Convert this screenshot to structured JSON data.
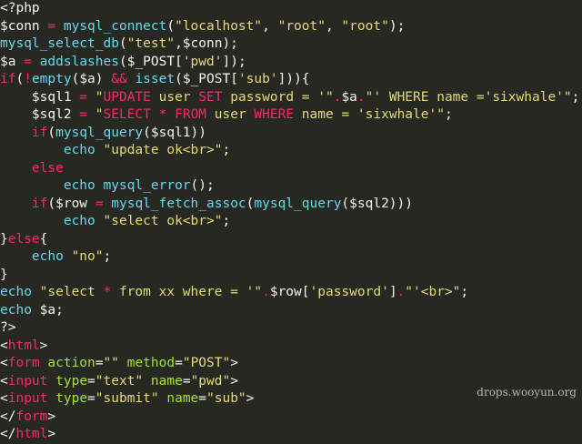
{
  "colors": {
    "background": "#272822",
    "default": "#f8f8f2",
    "function": "#66d9ef",
    "keyword": "#f92672",
    "string": "#e6db74",
    "attribute": "#a6e22e"
  },
  "watermark": "drops.wooyun.org",
  "lines": [
    [
      {
        "t": "<?php",
        "c": "default"
      }
    ],
    [
      {
        "t": "$conn",
        "c": "var"
      },
      {
        "t": " = ",
        "c": "op"
      },
      {
        "t": "mysql_connect",
        "c": "func"
      },
      {
        "t": "(",
        "c": "default"
      },
      {
        "t": "\"localhost\"",
        "c": "str"
      },
      {
        "t": ", ",
        "c": "default"
      },
      {
        "t": "\"root\"",
        "c": "str"
      },
      {
        "t": ", ",
        "c": "default"
      },
      {
        "t": "\"root\"",
        "c": "str"
      },
      {
        "t": ");",
        "c": "default"
      }
    ],
    [
      {
        "t": "mysql_select_db",
        "c": "func"
      },
      {
        "t": "(",
        "c": "default"
      },
      {
        "t": "\"test\"",
        "c": "str"
      },
      {
        "t": ",$conn);",
        "c": "default"
      }
    ],
    [
      {
        "t": "$a",
        "c": "var"
      },
      {
        "t": " = ",
        "c": "op"
      },
      {
        "t": "addslashes",
        "c": "func"
      },
      {
        "t": "($_POST[",
        "c": "default"
      },
      {
        "t": "'pwd'",
        "c": "str"
      },
      {
        "t": "]);",
        "c": "default"
      }
    ],
    [
      {
        "t": "if",
        "c": "kw"
      },
      {
        "t": "(",
        "c": "default"
      },
      {
        "t": "!",
        "c": "op"
      },
      {
        "t": "empty",
        "c": "func"
      },
      {
        "t": "($a) ",
        "c": "default"
      },
      {
        "t": "&&",
        "c": "op"
      },
      {
        "t": " ",
        "c": "default"
      },
      {
        "t": "isset",
        "c": "func"
      },
      {
        "t": "($_POST[",
        "c": "default"
      },
      {
        "t": "'sub'",
        "c": "str"
      },
      {
        "t": "])){",
        "c": "default"
      }
    ],
    [
      {
        "t": "    $sql1",
        "c": "var"
      },
      {
        "t": " = ",
        "c": "op"
      },
      {
        "t": "\"",
        "c": "str"
      },
      {
        "t": "UPDATE",
        "c": "kw"
      },
      {
        "t": " user ",
        "c": "str"
      },
      {
        "t": "SET",
        "c": "kw"
      },
      {
        "t": " password = '\"",
        "c": "str"
      },
      {
        "t": ".",
        "c": "op"
      },
      {
        "t": "$a",
        "c": "var"
      },
      {
        "t": ".",
        "c": "op"
      },
      {
        "t": "\"' WHERE name ='sixwhale'\"",
        "c": "str"
      },
      {
        "t": ";",
        "c": "default"
      }
    ],
    [
      {
        "t": "    $sql2",
        "c": "var"
      },
      {
        "t": " = ",
        "c": "op"
      },
      {
        "t": "\"",
        "c": "str"
      },
      {
        "t": "SELECT",
        "c": "kw"
      },
      {
        "t": " ",
        "c": "str"
      },
      {
        "t": "*",
        "c": "op"
      },
      {
        "t": " ",
        "c": "str"
      },
      {
        "t": "FROM",
        "c": "kw"
      },
      {
        "t": " user ",
        "c": "str"
      },
      {
        "t": "WHERE",
        "c": "kw"
      },
      {
        "t": " name = 'sixwhale'\"",
        "c": "str"
      },
      {
        "t": ";",
        "c": "default"
      }
    ],
    [
      {
        "t": "    ",
        "c": "default"
      },
      {
        "t": "if",
        "c": "kw"
      },
      {
        "t": "(",
        "c": "default"
      },
      {
        "t": "mysql_query",
        "c": "func"
      },
      {
        "t": "($sql1))",
        "c": "default"
      }
    ],
    [
      {
        "t": "        ",
        "c": "default"
      },
      {
        "t": "echo",
        "c": "func"
      },
      {
        "t": " ",
        "c": "default"
      },
      {
        "t": "\"update ok<br>\"",
        "c": "str"
      },
      {
        "t": ";",
        "c": "default"
      }
    ],
    [
      {
        "t": "    ",
        "c": "default"
      },
      {
        "t": "else",
        "c": "kw"
      }
    ],
    [
      {
        "t": "        ",
        "c": "default"
      },
      {
        "t": "echo",
        "c": "func"
      },
      {
        "t": " ",
        "c": "default"
      },
      {
        "t": "mysql_error",
        "c": "func"
      },
      {
        "t": "();",
        "c": "default"
      }
    ],
    [
      {
        "t": "    ",
        "c": "default"
      },
      {
        "t": "if",
        "c": "kw"
      },
      {
        "t": "($row ",
        "c": "default"
      },
      {
        "t": "=",
        "c": "op"
      },
      {
        "t": " ",
        "c": "default"
      },
      {
        "t": "mysql_fetch_assoc",
        "c": "func"
      },
      {
        "t": "(",
        "c": "default"
      },
      {
        "t": "mysql_query",
        "c": "func"
      },
      {
        "t": "($sql2)))",
        "c": "default"
      }
    ],
    [
      {
        "t": "        ",
        "c": "default"
      },
      {
        "t": "echo",
        "c": "func"
      },
      {
        "t": " ",
        "c": "default"
      },
      {
        "t": "\"select ok<br>\"",
        "c": "str"
      },
      {
        "t": ";",
        "c": "default"
      }
    ],
    [
      {
        "t": "}",
        "c": "default"
      },
      {
        "t": "else",
        "c": "kw"
      },
      {
        "t": "{",
        "c": "default"
      }
    ],
    [
      {
        "t": "    ",
        "c": "default"
      },
      {
        "t": "echo",
        "c": "func"
      },
      {
        "t": " ",
        "c": "default"
      },
      {
        "t": "\"no\"",
        "c": "str"
      },
      {
        "t": ";",
        "c": "default"
      }
    ],
    [
      {
        "t": "}",
        "c": "default"
      }
    ],
    [
      {
        "t": "echo",
        "c": "func"
      },
      {
        "t": " ",
        "c": "default"
      },
      {
        "t": "\"select ",
        "c": "str"
      },
      {
        "t": "*",
        "c": "op"
      },
      {
        "t": " from xx where = '\"",
        "c": "str"
      },
      {
        "t": ".",
        "c": "op"
      },
      {
        "t": "$row[",
        "c": "default"
      },
      {
        "t": "'password'",
        "c": "str"
      },
      {
        "t": "]",
        "c": "default"
      },
      {
        "t": ".",
        "c": "op"
      },
      {
        "t": "\"'<br>\"",
        "c": "str"
      },
      {
        "t": ";",
        "c": "default"
      }
    ],
    [
      {
        "t": "echo",
        "c": "func"
      },
      {
        "t": " $a;",
        "c": "default"
      }
    ],
    [
      {
        "t": "?>",
        "c": "default"
      }
    ],
    [
      {
        "t": "<",
        "c": "default"
      },
      {
        "t": "html",
        "c": "tag"
      },
      {
        "t": ">",
        "c": "default"
      }
    ],
    [
      {
        "t": "<",
        "c": "default"
      },
      {
        "t": "form",
        "c": "tag"
      },
      {
        "t": " ",
        "c": "default"
      },
      {
        "t": "action",
        "c": "attr"
      },
      {
        "t": "=",
        "c": "default"
      },
      {
        "t": "\"\"",
        "c": "str"
      },
      {
        "t": " ",
        "c": "default"
      },
      {
        "t": "method",
        "c": "attr"
      },
      {
        "t": "=",
        "c": "default"
      },
      {
        "t": "\"POST\"",
        "c": "str"
      },
      {
        "t": ">",
        "c": "default"
      }
    ],
    [
      {
        "t": "<",
        "c": "default"
      },
      {
        "t": "input",
        "c": "tag"
      },
      {
        "t": " ",
        "c": "default"
      },
      {
        "t": "type",
        "c": "attr"
      },
      {
        "t": "=",
        "c": "default"
      },
      {
        "t": "\"text\"",
        "c": "str"
      },
      {
        "t": " ",
        "c": "default"
      },
      {
        "t": "name",
        "c": "attr"
      },
      {
        "t": "=",
        "c": "default"
      },
      {
        "t": "\"pwd\"",
        "c": "str"
      },
      {
        "t": ">",
        "c": "default"
      }
    ],
    [
      {
        "t": "<",
        "c": "default"
      },
      {
        "t": "input",
        "c": "tag"
      },
      {
        "t": " ",
        "c": "default"
      },
      {
        "t": "type",
        "c": "attr"
      },
      {
        "t": "=",
        "c": "default"
      },
      {
        "t": "\"submit\"",
        "c": "str"
      },
      {
        "t": " ",
        "c": "default"
      },
      {
        "t": "name",
        "c": "attr"
      },
      {
        "t": "=",
        "c": "default"
      },
      {
        "t": "\"sub\"",
        "c": "str"
      },
      {
        "t": ">",
        "c": "default"
      }
    ],
    [
      {
        "t": "</",
        "c": "default"
      },
      {
        "t": "form",
        "c": "tag"
      },
      {
        "t": ">",
        "c": "default"
      }
    ],
    [
      {
        "t": "</",
        "c": "default"
      },
      {
        "t": "html",
        "c": "tag"
      },
      {
        "t": ">",
        "c": "default"
      }
    ]
  ]
}
